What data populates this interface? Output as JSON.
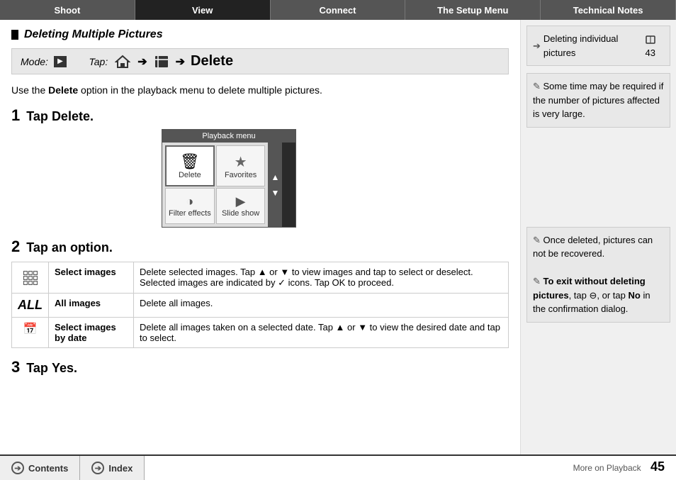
{
  "nav": {
    "tabs": [
      {
        "label": "Shoot",
        "active": false
      },
      {
        "label": "View",
        "active": true
      },
      {
        "label": "Connect",
        "active": false
      },
      {
        "label": "The Setup Menu",
        "active": false
      },
      {
        "label": "Technical Notes",
        "active": false
      }
    ]
  },
  "page": {
    "title": "Deleting Multiple Pictures",
    "mode_label": "Mode:",
    "tap_label": "Tap:",
    "delete_label": "Delete",
    "intro": "Use the ",
    "intro_bold": "Delete",
    "intro_rest": " option in the playback menu to delete multiple pictures.",
    "step1_label": "1",
    "step1_text": "Tap ",
    "step1_bold": "Delete.",
    "step2_label": "2",
    "step2_text": "Tap an option.",
    "step3_label": "3",
    "step3_text": "Tap ",
    "step3_bold": "Yes."
  },
  "playback_menu": {
    "title": "Playback menu",
    "items": [
      {
        "label": "Delete",
        "selected": true
      },
      {
        "label": "Favorites"
      },
      {
        "label": "Filter effects"
      },
      {
        "label": "Slide show"
      }
    ]
  },
  "options_table": {
    "rows": [
      {
        "icon_type": "grid",
        "name": "Select images",
        "desc": "Delete selected images. Tap ▲ or ▼ to view images and tap to select or deselect. Selected images are indicated by ✓ icons. Tap OK to proceed."
      },
      {
        "icon_type": "all",
        "name": "All images",
        "desc": "Delete all images."
      },
      {
        "icon_type": "calendar",
        "name": "Select images by date",
        "desc": "Delete all images taken on a selected date. Tap ▲ or ▼ to view the desired date and tap to select."
      }
    ]
  },
  "sidebar": {
    "top_ref": {
      "icon": "➔",
      "label": "Deleting individual pictures",
      "page": "43"
    },
    "top_note": "Some time may be required if the number of pictures affected is very large.",
    "bottom_note1": "Once deleted, pictures can not be recovered.",
    "bottom_note2_bold": "To exit without deleting pictures",
    "bottom_note2_rest": ", tap ",
    "bottom_note2_icon": "⊖",
    "bottom_note2_end": ", or tap ",
    "bottom_note2_no": "No",
    "bottom_note2_final": " in the confirmation dialog."
  },
  "bottom": {
    "contents_label": "Contents",
    "index_label": "Index",
    "more_on": "More on Playback",
    "page_number": "45"
  }
}
